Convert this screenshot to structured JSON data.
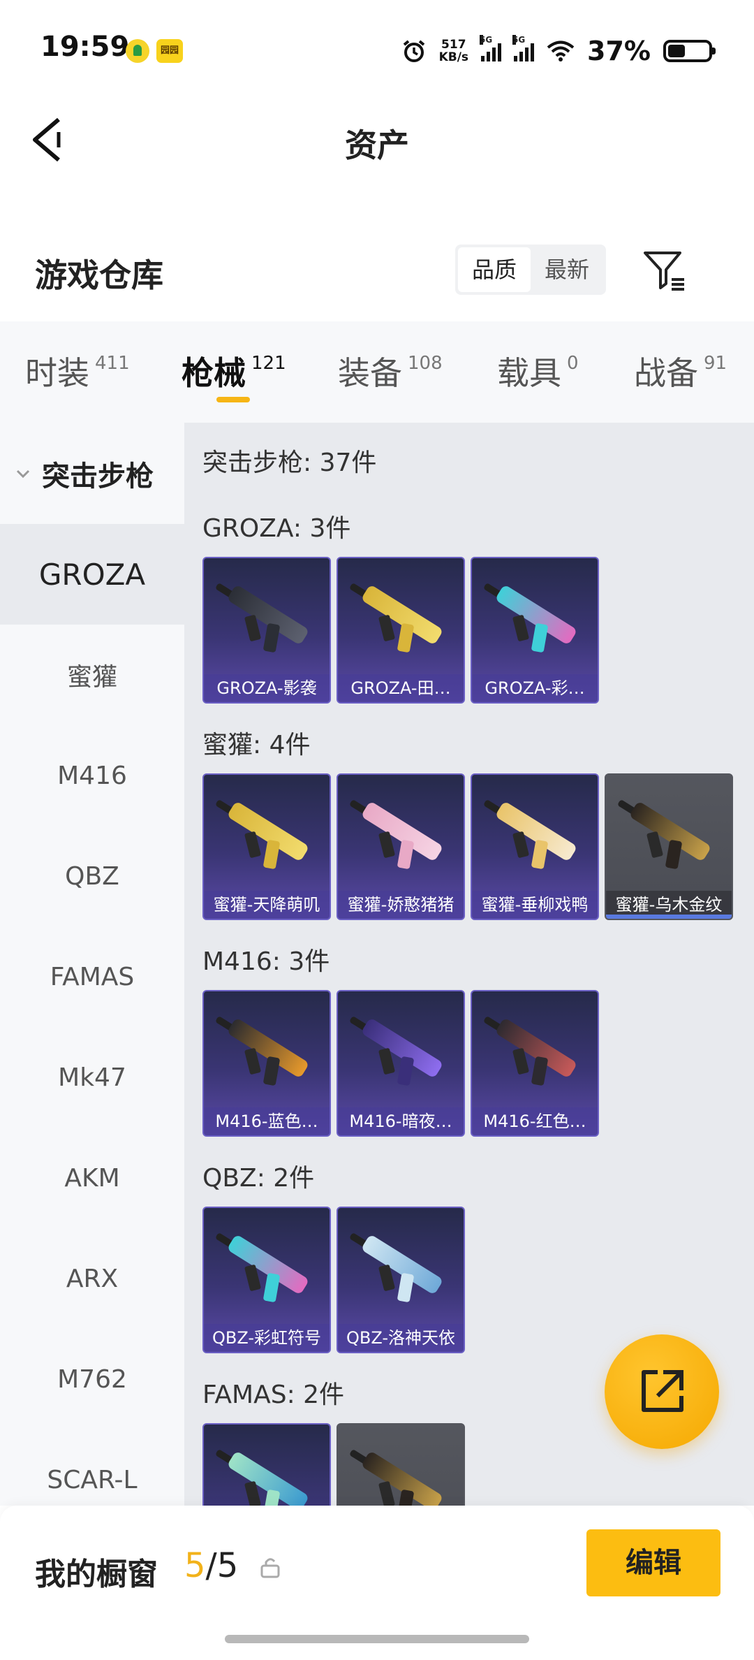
{
  "status_bar": {
    "time": "19:59",
    "app2_text": "园园",
    "speed_value": "517",
    "speed_unit": "KB/s",
    "net1": "5G",
    "net2": "5G",
    "battery_pct": "37%"
  },
  "header": {
    "title": "资产"
  },
  "warehouse": {
    "title": "游戏仓库",
    "sort_options": [
      "品质",
      "最新"
    ],
    "sort_selected": "品质"
  },
  "tabs": [
    {
      "label": "时装",
      "count": "411"
    },
    {
      "label": "枪械",
      "count": "121",
      "active": true
    },
    {
      "label": "装备",
      "count": "108"
    },
    {
      "label": "载具",
      "count": "0"
    },
    {
      "label": "战备",
      "count": "91"
    }
  ],
  "sidebar": {
    "group": "突击步枪",
    "items": [
      "GROZA",
      "蜜獾",
      "M416",
      "QBZ",
      "FAMAS",
      "Mk47",
      "AKM",
      "ARX",
      "M762",
      "SCAR-L"
    ],
    "active": "GROZA"
  },
  "main": {
    "summary": "突击步枪: 37件",
    "groups": [
      {
        "title": "GROZA: 3件",
        "items": [
          {
            "name": "GROZA-影袭",
            "style": "dark"
          },
          {
            "name": "GROZA-田…",
            "style": "gold"
          },
          {
            "name": "GROZA-彩…",
            "style": "rainbow"
          }
        ]
      },
      {
        "title": "蜜獾: 4件",
        "items": [
          {
            "name": "蜜獾-天降萌叽",
            "style": "gold"
          },
          {
            "name": "蜜獾-娇憨猪猪",
            "style": "pink"
          },
          {
            "name": "蜜獾-垂柳戏鸭",
            "style": "cream"
          },
          {
            "name": "蜜獾-乌木金纹",
            "style": "ebony",
            "gray": true
          }
        ]
      },
      {
        "title": "M416: 3件",
        "items": [
          {
            "name": "M416-蓝色…",
            "style": "orange"
          },
          {
            "name": "M416-暗夜…",
            "style": "purple"
          },
          {
            "name": "M416-红色…",
            "style": "red"
          }
        ]
      },
      {
        "title": "QBZ: 2件",
        "items": [
          {
            "name": "QBZ-彩虹符号",
            "style": "rainbow"
          },
          {
            "name": "QBZ-洛神天依",
            "style": "ice"
          }
        ]
      },
      {
        "title": "FAMAS: 2件",
        "items": [
          {
            "name": "",
            "style": "teal"
          },
          {
            "name": "",
            "style": "ebony",
            "gray": true
          }
        ]
      }
    ]
  },
  "bottom": {
    "showcase_label": "我的橱窗",
    "count_current": "5",
    "count_sep": "/",
    "count_total": "5",
    "edit_label": "编辑"
  },
  "colors": {
    "accent": "#fcbd11",
    "tab_indicator": "#f6b515",
    "card_purple": "#3a3574",
    "card_gray": "#4a4c54"
  },
  "icons": {
    "back": "chevron-left-icon",
    "filter": "filter-icon",
    "share": "share-icon",
    "lock": "lock-icon"
  }
}
